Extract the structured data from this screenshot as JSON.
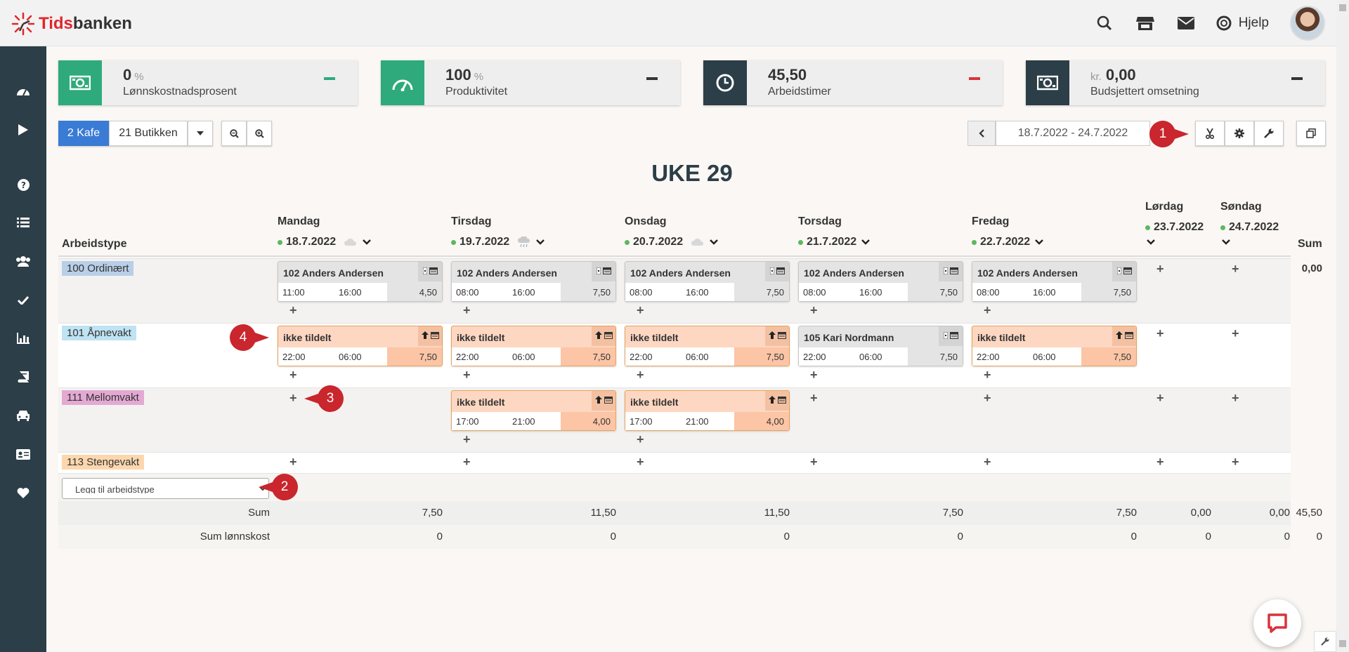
{
  "brand": {
    "part1": "Tids",
    "part2": "banken"
  },
  "header": {
    "help_label": "Hjelp"
  },
  "stats": [
    {
      "value": "0",
      "unit": "%",
      "prefix": "",
      "label": "Lønnskostnadsprosent",
      "icon": "money-icon",
      "icon_bg": "#2eaa7c",
      "dash_color": "#2eaa7c"
    },
    {
      "value": "100",
      "unit": "%",
      "prefix": "",
      "label": "Produktivitet",
      "icon": "gauge-icon",
      "icon_bg": "#2eaa7c",
      "dash_color": "#333333"
    },
    {
      "value": "45,50",
      "unit": "",
      "prefix": "",
      "label": "Arbeidstimer",
      "icon": "clock-icon",
      "icon_bg": "#2c3e47",
      "dash_color": "#d9343b"
    },
    {
      "value": "0,00",
      "unit": "",
      "prefix": "kr.",
      "label": "Budsjettert omsetning",
      "icon": "money-icon",
      "icon_bg": "#2c3e47",
      "dash_color": "#333333"
    }
  ],
  "toolbar": {
    "dept_active": "2 Kafe",
    "dept_other": "21 Butikken",
    "date_range": "18.7.2022 - 24.7.2022"
  },
  "week_title": "UKE 29",
  "grid": {
    "worktype_header": "Arbeidstype",
    "sum_header": "Sum",
    "days": [
      {
        "name": "Mandag",
        "date": "18.7.2022",
        "weather": "cloud-icon"
      },
      {
        "name": "Tirsdag",
        "date": "19.7.2022",
        "weather": "rain-icon"
      },
      {
        "name": "Onsdag",
        "date": "20.7.2022",
        "weather": "cloud-icon"
      },
      {
        "name": "Torsdag",
        "date": "21.7.2022",
        "weather": ""
      },
      {
        "name": "Fredag",
        "date": "22.7.2022",
        "weather": ""
      },
      {
        "name": "Lørdag",
        "date": "23.7.2022",
        "weather": ""
      },
      {
        "name": "Søndag",
        "date": "24.7.2022",
        "weather": ""
      }
    ],
    "rows": [
      {
        "label": "100 Ordinært",
        "color": "#b8cfe8",
        "sum": "0,00"
      },
      {
        "label": "101 Åpnevakt",
        "color": "#bfe3f2",
        "sum": ""
      },
      {
        "label": "111 Mellomvakt",
        "color": "#e3a9d3",
        "sum": ""
      },
      {
        "label": "113 Stengevakt",
        "color": "#fcd7ae",
        "sum": ""
      }
    ],
    "shifts": [
      {
        "name": "102 Anders Andersen",
        "start": "11:00",
        "end": "16:00",
        "hours": "4,50",
        "open": false
      },
      {
        "name": "102 Anders Andersen",
        "start": "08:00",
        "end": "16:00",
        "hours": "7,50",
        "open": false
      },
      {
        "name": "102 Anders Andersen",
        "start": "08:00",
        "end": "16:00",
        "hours": "7,50",
        "open": false
      },
      {
        "name": "102 Anders Andersen",
        "start": "08:00",
        "end": "16:00",
        "hours": "7,50",
        "open": false
      },
      {
        "name": "102 Anders Andersen",
        "start": "08:00",
        "end": "16:00",
        "hours": "7,50",
        "open": false
      },
      {
        "name": "ikke tildelt",
        "start": "22:00",
        "end": "06:00",
        "hours": "7,50",
        "open": true
      },
      {
        "name": "ikke tildelt",
        "start": "22:00",
        "end": "06:00",
        "hours": "7,50",
        "open": true
      },
      {
        "name": "ikke tildelt",
        "start": "22:00",
        "end": "06:00",
        "hours": "7,50",
        "open": true
      },
      {
        "name": "105 Kari Nordmann",
        "start": "22:00",
        "end": "06:00",
        "hours": "7,50",
        "open": false
      },
      {
        "name": "ikke tildelt",
        "start": "22:00",
        "end": "06:00",
        "hours": "7,50",
        "open": true
      },
      {
        "name": "ikke tildelt",
        "start": "17:00",
        "end": "21:00",
        "hours": "4,00",
        "open": true
      },
      {
        "name": "ikke tildelt",
        "start": "17:00",
        "end": "21:00",
        "hours": "4,00",
        "open": true
      }
    ],
    "add_worktype_placeholder": "Legg til arbeidstype",
    "sum_label": "Sum",
    "sum_values": [
      "7,50",
      "11,50",
      "11,50",
      "7,50",
      "7,50",
      "0,00",
      "0,00",
      "45,50"
    ],
    "cost_label": "Sum lønnskost",
    "cost_values": [
      "0",
      "0",
      "0",
      "0",
      "0",
      "0",
      "0",
      "0"
    ]
  },
  "callouts": [
    "1",
    "2",
    "3",
    "4"
  ],
  "colors": {
    "accent": "#3a7bd5",
    "sidebar": "#2c3e47",
    "callout": "#c9262d",
    "open_shift": "#fdd7c2"
  }
}
